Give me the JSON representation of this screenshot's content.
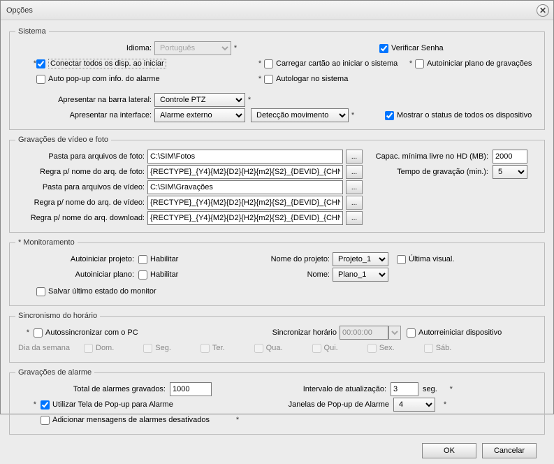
{
  "title": "Opções",
  "sistema": {
    "legend": "Sistema",
    "idioma_label": "Idioma:",
    "idioma_value": "Português",
    "verificar_senha": "Verificar Senha",
    "conectar_disp": "Conectar todos os disp. ao iniciar",
    "carregar_cartao": "Carregar cartão ao iniciar o sistema",
    "autoiniciar_plano": "Autoiniciar plano de gravações",
    "auto_popup": "Auto pop-up com info. do alarme",
    "autologar": "Autologar no sistema",
    "barra_lateral_label": "Apresentar na barra lateral:",
    "barra_lateral_value": "Controle PTZ",
    "interface_label": "Apresentar na interface:",
    "interface_value_1": "Alarme externo",
    "interface_value_2": "Detecção movimento",
    "mostrar_status": "Mostrar o status de todos os dispositivo"
  },
  "gravacoes": {
    "legend": "Gravações de vídeo e foto",
    "pasta_foto_label": "Pasta para arquivos de foto:",
    "pasta_foto_value": "C:\\SIM\\Fotos",
    "regra_foto_label": "Regra p/ nome do arq. de foto:",
    "regra_foto_value": "{RECTYPE}_{Y4}{M2}{D2}{H2}{m2}{S2}_{DEVID}_{CHN",
    "pasta_video_label": "Pasta para arquivos de vídeo:",
    "pasta_video_value": "C:\\SIM\\Gravações",
    "regra_video_label": "Regra p/ nome do arq. de vídeo:",
    "regra_video_value": "{RECTYPE}_{Y4}{M2}{D2}{H2}{m2}{S2}_{DEVID}_{CHN",
    "regra_download_label": "Regra p/ nome do arq. download:",
    "regra_download_value": "{RECTYPE}_{Y4}{M2}{D2}{H2}{m2}{S2}_{DEVID}_{CHN",
    "capac_label": "Capac. mínima livre no HD (MB):",
    "capac_value": "2000",
    "tempo_label": "Tempo de gravação (min.):",
    "tempo_value": "5",
    "browse": "..."
  },
  "monitoramento": {
    "legend": "* Monitoramento",
    "autoiniciar_projeto_label": "Autoiniciar projeto:",
    "autoiniciar_plano_label": "Autoiniciar plano:",
    "habilitar": "Habilitar",
    "nome_projeto_label": "Nome do projeto:",
    "nome_projeto_value": "Projeto_1",
    "nome_label": "Nome:",
    "nome_value": "Plano_1",
    "ultima_visual": "Última visual.",
    "salvar_estado": "Salvar último estado do monitor"
  },
  "sincronismo": {
    "legend": "Sincronismo do horário",
    "autossinc": "Autossincronizar com o PC",
    "sinc_horario_label": "Sincronizar horário",
    "sinc_horario_value": "00:00:00",
    "autorreiniciar": "Autorreiniciar dispositivo",
    "dia_semana_label": "Dia da semana",
    "dias": [
      "Dom.",
      "Seg.",
      "Ter.",
      "Qua.",
      "Qui.",
      "Sex.",
      "Sáb."
    ]
  },
  "alarme": {
    "legend": "Gravações de alarme",
    "total_label": "Total de alarmes gravados:",
    "total_value": "1000",
    "intervalo_label": "Intervalo de atualização:",
    "intervalo_value": "3",
    "seg": "seg.",
    "utilizar_popup": "Utilizar Tela de Pop-up para Alarme",
    "janelas_label": "Janelas de Pop-up de Alarme",
    "janelas_value": "4",
    "adicionar_msg": "Adicionar mensagens de alarmes desativados"
  },
  "buttons": {
    "ok": "OK",
    "cancel": "Cancelar"
  },
  "ast": "*"
}
